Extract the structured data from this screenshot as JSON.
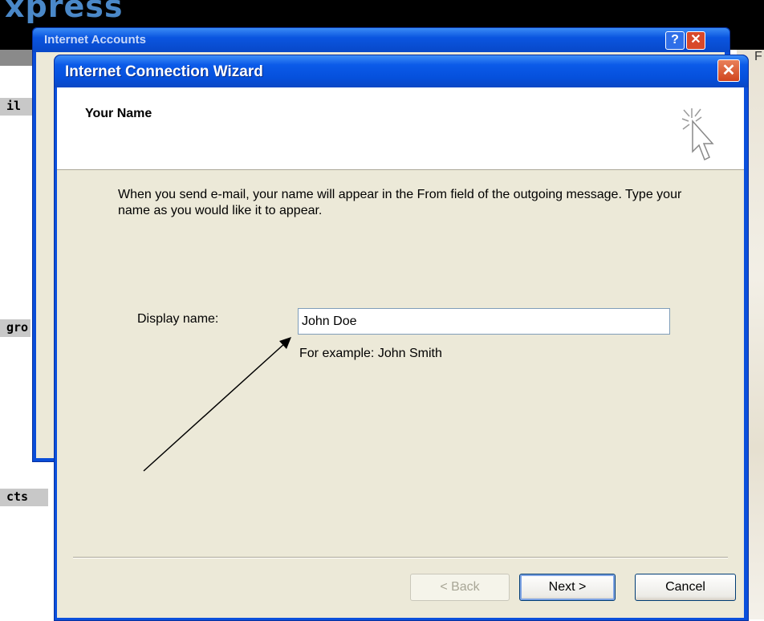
{
  "background": {
    "logo_text": "xpress",
    "right_letter": "F",
    "left_labels": [
      "il",
      "gro",
      "cts"
    ]
  },
  "accounts_window": {
    "title": "Internet Accounts",
    "help_label": "?",
    "close_label": "✕"
  },
  "wizard": {
    "title": "Internet Connection Wizard",
    "close_label": "✕",
    "header_title": "Your Name",
    "description": "When you send e-mail, your name will appear in the From field of the outgoing message. Type your name as you would like it to appear.",
    "display_name_label": "Display name:",
    "display_name_value": "John Doe",
    "example_text": "For example: John Smith",
    "buttons": {
      "back": "< Back",
      "next": "Next >",
      "cancel": "Cancel"
    }
  },
  "colors": {
    "xp_blue": "#0b50dc",
    "dialog_face": "#ece9d8",
    "close_red": "#d0451e"
  }
}
